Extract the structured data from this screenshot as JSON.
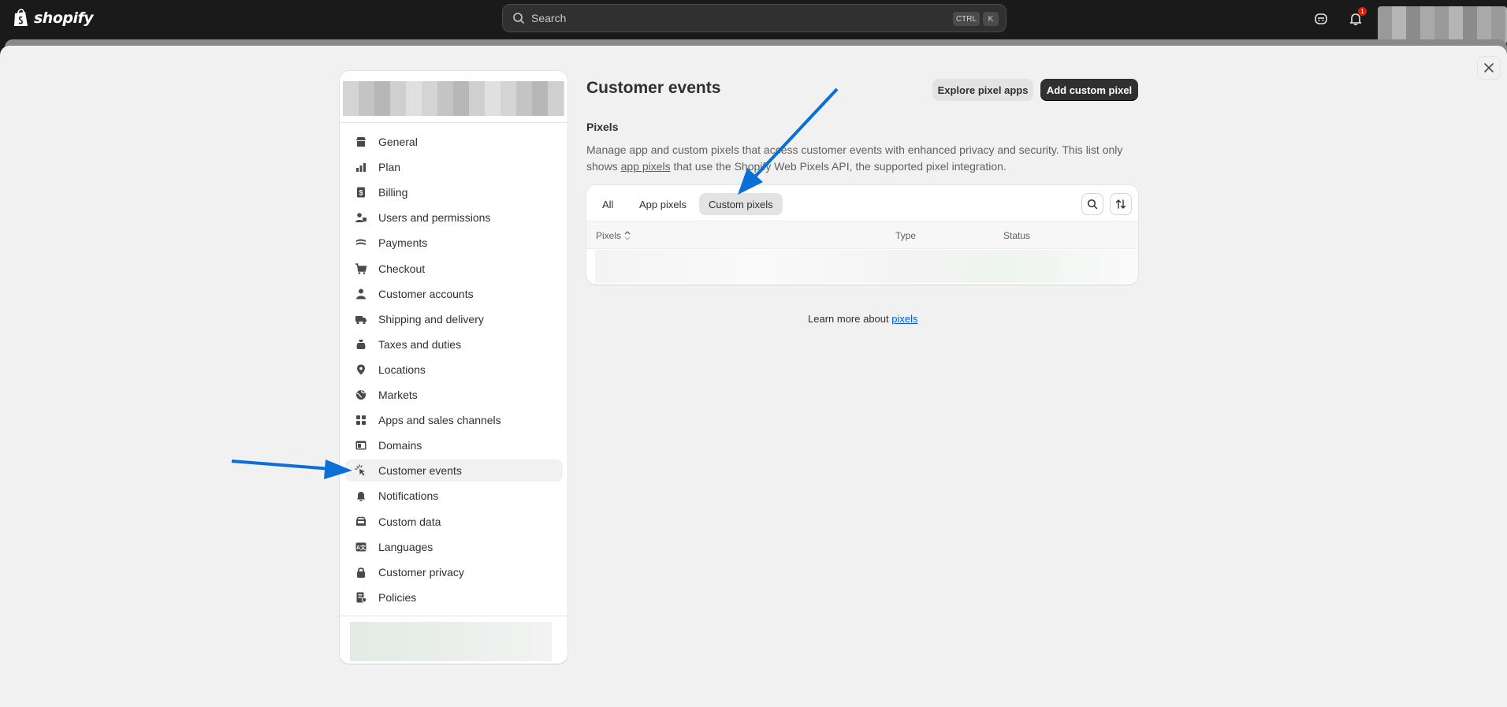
{
  "topbar": {
    "brand": "shopify",
    "search_placeholder": "Search",
    "shortcut_ctrl": "CTRL",
    "shortcut_k": "K",
    "notification_count": "1"
  },
  "sidebar": {
    "items": [
      {
        "label": "General",
        "icon": "store-icon"
      },
      {
        "label": "Plan",
        "icon": "plan-chart-icon"
      },
      {
        "label": "Billing",
        "icon": "billing-icon"
      },
      {
        "label": "Users and permissions",
        "icon": "users-icon"
      },
      {
        "label": "Payments",
        "icon": "payments-icon"
      },
      {
        "label": "Checkout",
        "icon": "cart-icon"
      },
      {
        "label": "Customer accounts",
        "icon": "person-icon"
      },
      {
        "label": "Shipping and delivery",
        "icon": "truck-icon"
      },
      {
        "label": "Taxes and duties",
        "icon": "tax-bag-icon"
      },
      {
        "label": "Locations",
        "icon": "location-pin-icon"
      },
      {
        "label": "Markets",
        "icon": "globe-icon"
      },
      {
        "label": "Apps and sales channels",
        "icon": "apps-icon"
      },
      {
        "label": "Domains",
        "icon": "domain-icon"
      },
      {
        "label": "Customer events",
        "icon": "cursor-click-icon",
        "active": true
      },
      {
        "label": "Notifications",
        "icon": "bell-icon"
      },
      {
        "label": "Custom data",
        "icon": "custom-data-icon"
      },
      {
        "label": "Languages",
        "icon": "language-icon"
      },
      {
        "label": "Customer privacy",
        "icon": "lock-icon"
      },
      {
        "label": "Policies",
        "icon": "policies-icon"
      }
    ]
  },
  "main": {
    "title": "Customer events",
    "explore_button": "Explore pixel apps",
    "add_button": "Add custom pixel",
    "section_title": "Pixels",
    "desc_part1": "Manage app and custom pixels that access customer events with enhanced privacy and security. This list only shows ",
    "desc_link": "app pixels",
    "desc_part2": " that use the Shopify Web Pixels API, the supported pixel integration.",
    "tabs": [
      {
        "label": "All"
      },
      {
        "label": "App pixels"
      },
      {
        "label": "Custom pixels",
        "active": true
      }
    ],
    "table_headers": {
      "pixels": "Pixels",
      "type": "Type",
      "status": "Status"
    },
    "learn_more_text": "Learn more about ",
    "learn_more_link": "pixels"
  },
  "colors": {
    "accent": "#005bd3",
    "annotation_arrow": "#0a6fd6",
    "primary_button": "#303030"
  }
}
